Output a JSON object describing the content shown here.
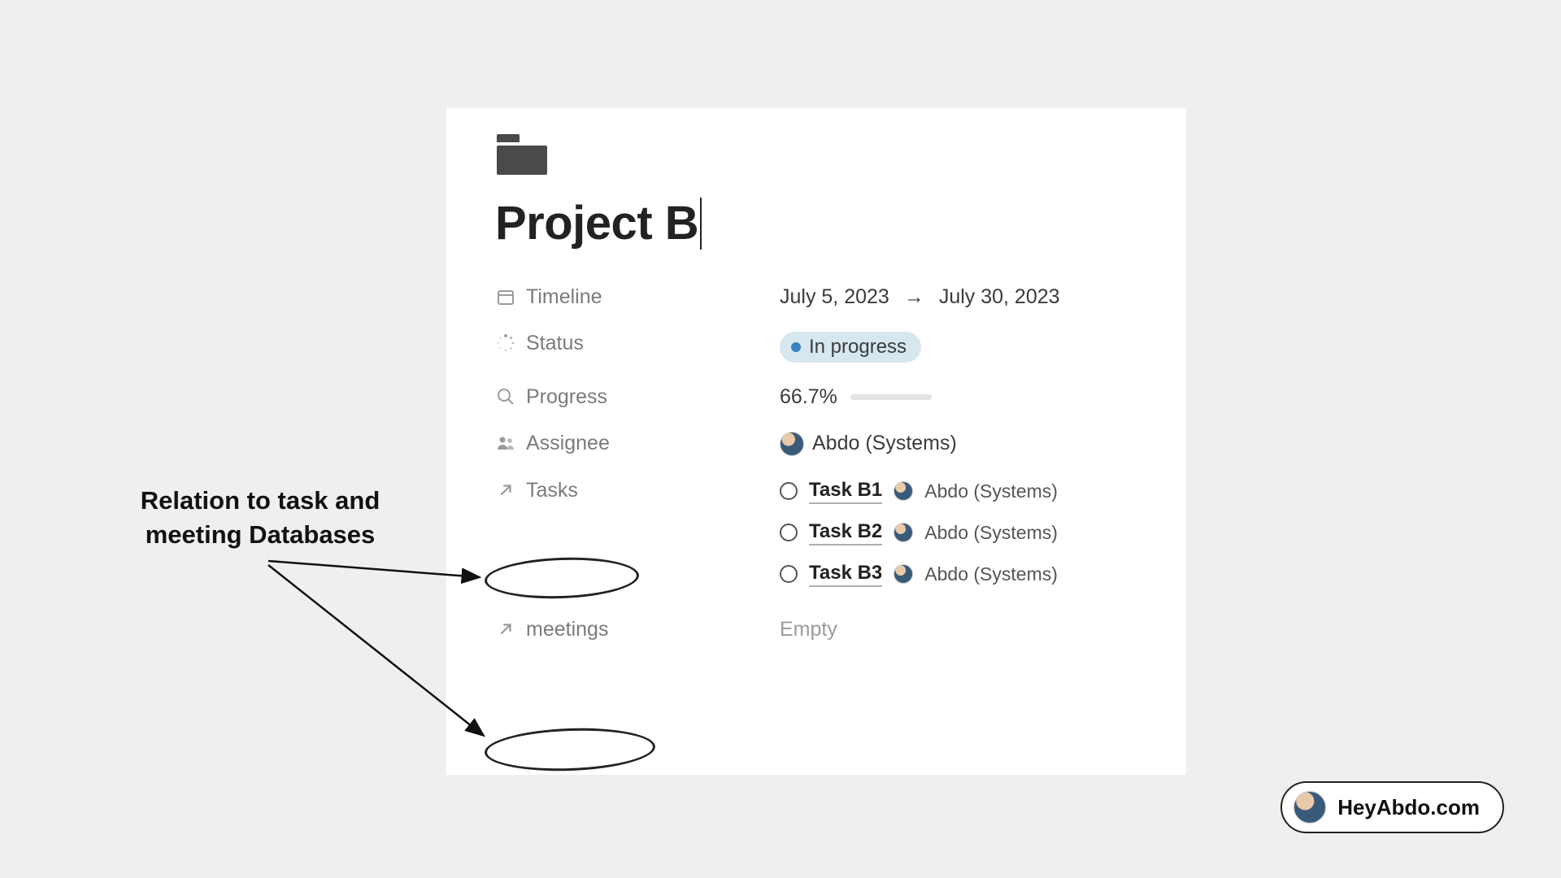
{
  "annotation": {
    "text": "Relation to task and meeting Databases"
  },
  "page": {
    "title": "Project B",
    "icon": "folder-icon",
    "properties": {
      "timeline": {
        "label": "Timeline",
        "from": "July 5, 2023",
        "to": "July 30, 2023"
      },
      "status": {
        "label": "Status",
        "value": "In progress",
        "color": "#3b82c4"
      },
      "progress": {
        "label": "Progress",
        "value_text": "66.7%",
        "value_pct": 66.7
      },
      "assignee": {
        "label": "Assignee",
        "name": "Abdo (Systems)"
      },
      "tasks": {
        "label": "Tasks",
        "items": [
          {
            "name": "Task B1",
            "assignee": "Abdo (Systems)"
          },
          {
            "name": "Task B2",
            "assignee": "Abdo (Systems)"
          },
          {
            "name": "Task B3",
            "assignee": "Abdo (Systems)"
          }
        ]
      },
      "meetings": {
        "label": "meetings",
        "value": "Empty"
      }
    }
  },
  "brand": {
    "text": "HeyAbdo.com"
  }
}
